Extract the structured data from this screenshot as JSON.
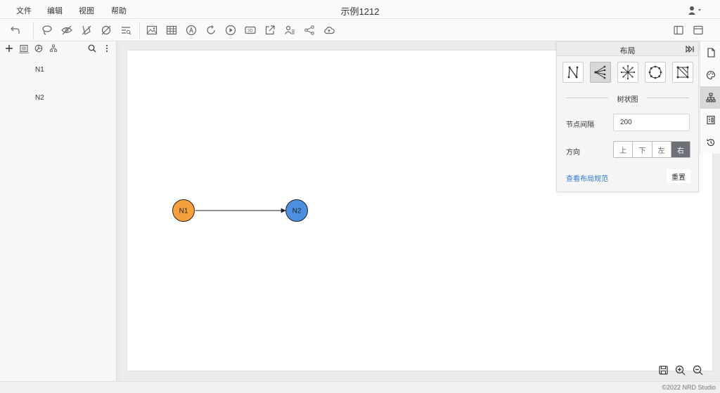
{
  "menu": {
    "items": [
      "文件",
      "编辑",
      "视图",
      "帮助"
    ],
    "title": "示例1212"
  },
  "toolbar": {
    "icons": [
      "undo-icon",
      "lasso-icon",
      "hide-icon",
      "show-hidden-icon",
      "clear-icon",
      "search-graph-icon",
      "image-icon",
      "table-icon",
      "text-annotation-icon",
      "refresh-icon",
      "play-icon",
      "3d-icon",
      "export-icon",
      "community-icon",
      "share-icon",
      "cloud-upload-icon",
      "sidebar-toggle-icon",
      "window-icon"
    ]
  },
  "left_panel": {
    "tools": [
      "add-icon",
      "list-view-icon",
      "pie-chart-icon",
      "tree-view-icon",
      "search-icon",
      "more-icon"
    ],
    "nodes": [
      "N1",
      "N2"
    ]
  },
  "graph": {
    "nodes": [
      {
        "label": "N1",
        "color": "#f5a03a"
      },
      {
        "label": "N2",
        "color": "#4a8fe0"
      }
    ],
    "edge_color": "#222222"
  },
  "layout_panel": {
    "title": "布局",
    "layouts": [
      "force-layout-icon",
      "tree-layout-icon",
      "radial-layout-icon",
      "circle-layout-icon",
      "grid-layout-icon"
    ],
    "active_layout": 1,
    "section_title": "树状图",
    "spacing_label": "节点间隔",
    "spacing_value": "200",
    "direction_label": "方向",
    "directions": [
      "上",
      "下",
      "左",
      "右"
    ],
    "active_direction": 3,
    "spec_link": "查看布局规范",
    "reset": "重置"
  },
  "right_strip": {
    "icons": [
      "document-icon",
      "palette-icon",
      "layout-icon",
      "stats-icon",
      "history-icon"
    ],
    "active": 2
  },
  "footer": {
    "copyright": "©2022 NRD Studio"
  },
  "colors": {
    "active_direction": "#6b7177",
    "link": "#2f7bd6"
  }
}
